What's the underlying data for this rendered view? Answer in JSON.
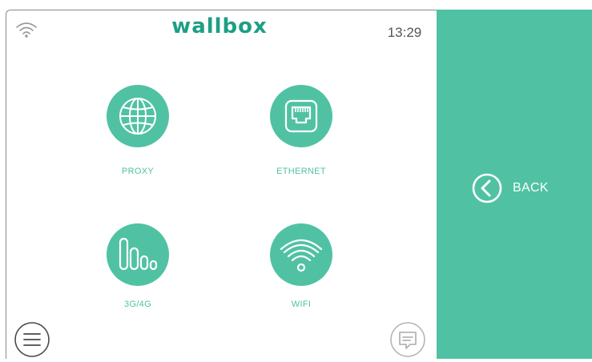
{
  "header": {
    "brand": "wallbox",
    "time": "13:29",
    "status_icon": "wifi-signal-icon"
  },
  "connectivity_options": [
    {
      "label": "PROXY",
      "icon": "globe-icon"
    },
    {
      "label": "ETHERNET",
      "icon": "ethernet-port-icon"
    },
    {
      "label": "3G/4G",
      "icon": "cellular-signal-icon"
    },
    {
      "label": "WIFI",
      "icon": "wifi-icon"
    }
  ],
  "footer": {
    "menu_icon": "menu-icon",
    "chat_icon": "chat-icon"
  },
  "back": {
    "label": "BACK",
    "icon": "chevron-left-circle-icon"
  },
  "colors": {
    "accent": "#50c2a3",
    "logo": "#1e9f84",
    "text_dark": "#555555",
    "muted_gray": "#b5b5b5"
  }
}
